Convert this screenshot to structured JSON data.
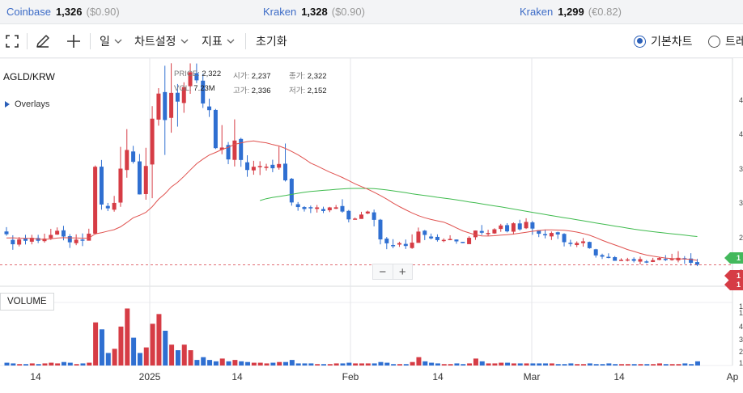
{
  "ticker": [
    {
      "exchange": "Coinbase",
      "price": "1,326",
      "change": "($0.90)"
    },
    {
      "exchange": "Kraken",
      "price": "1,328",
      "change": "($0.90)"
    },
    {
      "exchange": "Kraken",
      "price": "1,299",
      "change": "(€0.82)"
    }
  ],
  "toolbar": {
    "period": "일",
    "chart_settings": "차트설정",
    "indicators": "지표",
    "reset": "초기화",
    "basic_chart": "기본차트",
    "trading_chart_partial": "트레"
  },
  "chart": {
    "symbol": "AGLD/KRW",
    "overlays_label": "Overlays",
    "ohlc": {
      "price_label": "PRICE:",
      "price": "2,322",
      "open_label": "시가:",
      "open": "2,237",
      "close_label": "종가:",
      "close": "2,322",
      "vol_label": "VOL:",
      "vol": "7.23M",
      "high_label": "고가:",
      "high": "2,336",
      "low_label": "저가:",
      "low": "2,152"
    },
    "volume_label": "VOLUME",
    "zoom_out": "−",
    "zoom_in": "+",
    "x_labels": [
      "14",
      "2025",
      "14",
      "Feb",
      "14",
      "Mar",
      "14",
      "Ap"
    ],
    "price_tags": [
      {
        "text": "1",
        "color": "#43b85c"
      },
      {
        "text": "1",
        "color": "#d63c45"
      },
      {
        "text": "1",
        "color": "#d63c45"
      }
    ],
    "y_axis_partial": [
      "4",
      "4",
      "3",
      "3",
      "2",
      "2",
      "1",
      "1",
      "4",
      "3",
      "2",
      "1"
    ],
    "colors": {
      "up": "#d63c45",
      "down": "#2f6fd1",
      "ma_short": "#e0524f",
      "ma_long": "#3fbb4e"
    }
  },
  "chart_data": {
    "type": "candlestick",
    "note_series": [
      "price candles",
      "short moving average",
      "long moving average",
      "volume bars"
    ],
    "candles": [
      [
        2096,
        2072,
        2134,
        2059
      ],
      [
        2023,
        1985,
        2063,
        1937
      ],
      [
        1982,
        2027,
        2048,
        1966
      ],
      [
        2035,
        2015,
        2067,
        1983
      ],
      [
        2007,
        2041,
        2067,
        1984
      ],
      [
        2039,
        2015,
        2067,
        1995
      ],
      [
        2012,
        2034,
        2077,
        1999
      ],
      [
        2037,
        2066,
        2119,
        2022
      ],
      [
        2069,
        2102,
        2131,
        2066
      ],
      [
        2106,
        2052,
        2145,
        2019
      ],
      [
        2055,
        2002,
        2073,
        1953
      ],
      [
        1994,
        2025,
        2071,
        1977
      ],
      [
        2026,
        2021,
        2079,
        1969
      ],
      [
        2016,
        2077,
        2120,
        2065
      ],
      [
        2077,
        2658,
        2669,
        2069
      ],
      [
        2659,
        2330,
        2717,
        2285
      ],
      [
        2318,
        2297,
        2344,
        2273
      ],
      [
        2285,
        2344,
        2405,
        2268
      ],
      [
        2347,
        2642,
        2831,
        2310
      ],
      [
        2630,
        2804,
        2985,
        2563
      ],
      [
        2791,
        2701,
        2840,
        2686
      ],
      [
        2705,
        2418,
        2769,
        2417
      ],
      [
        2421,
        2665,
        2823,
        2372
      ],
      [
        2678,
        3076,
        3185,
        2385
      ],
      [
        3068,
        3294,
        3341,
        3015
      ],
      [
        3307,
        3064,
        3536,
        2761
      ],
      [
        3083,
        3300,
        3557,
        2954
      ],
      [
        3301,
        3224,
        3377,
        3007
      ],
      [
        3212,
        3350,
        3392,
        3127
      ],
      [
        3358,
        3479,
        3556,
        3292
      ],
      [
        3472,
        3409,
        3555,
        3385
      ],
      [
        3406,
        3208,
        3466,
        3169
      ],
      [
        3182,
        3150,
        3250,
        3091
      ],
      [
        3152,
        2820,
        3161,
        2812
      ],
      [
        2806,
        2825,
        3020,
        2767
      ],
      [
        2847,
        2722,
        2873,
        2681
      ],
      [
        2718,
        2886,
        3070,
        2661
      ],
      [
        2900,
        2717,
        2910,
        2658
      ],
      [
        2697,
        2630,
        2758,
        2571
      ],
      [
        2627,
        2658,
        2710,
        2589
      ],
      [
        2656,
        2665,
        2706,
        2586
      ],
      [
        2648,
        2659,
        2684,
        2625
      ],
      [
        2675,
        2645,
        2719,
        2611
      ],
      [
        2650,
        2682,
        2834,
        2633
      ],
      [
        2685,
        2540,
        2860,
        2530
      ],
      [
        2554,
        2348,
        2561,
        2320
      ],
      [
        2333,
        2308,
        2352,
        2276
      ],
      [
        2308,
        2291,
        2316,
        2269
      ],
      [
        2307,
        2299,
        2321,
        2256
      ],
      [
        2292,
        2305,
        2326,
        2260
      ],
      [
        2291,
        2274,
        2311,
        2256
      ],
      [
        2280,
        2305,
        2310,
        2264
      ],
      [
        2293,
        2306,
        2326,
        2291
      ],
      [
        2317,
        2269,
        2376,
        2259
      ],
      [
        2275,
        2201,
        2283,
        2175
      ],
      [
        2203,
        2208,
        2217,
        2200
      ],
      [
        2205,
        2243,
        2267,
        2206
      ],
      [
        2252,
        2269,
        2277,
        2247
      ],
      [
        2262,
        2197,
        2286,
        2140
      ],
      [
        2198,
        2027,
        2205,
        1984
      ],
      [
        2034,
        1993,
        2048,
        1942
      ],
      [
        1978,
        1968,
        2029,
        1950
      ],
      [
        1982,
        1995,
        2007,
        1962
      ],
      [
        1988,
        1970,
        2026,
        1944
      ],
      [
        1952,
        1999,
        2071,
        1945
      ],
      [
        1997,
        2095,
        2130,
        2000
      ],
      [
        2103,
        2066,
        2109,
        2021
      ],
      [
        2052,
        2036,
        2078,
        2027
      ],
      [
        2049,
        2021,
        2071,
        2008
      ],
      [
        2020,
        2023,
        2036,
        2003
      ],
      [
        2025,
        2031,
        2063,
        2020
      ],
      [
        2026,
        2010,
        2027,
        1989
      ],
      [
        2006,
        1997,
        2001,
        1995
      ],
      [
        1986,
        2041,
        2054,
        1998
      ],
      [
        2046,
        2104,
        2105,
        2023
      ],
      [
        2100,
        2085,
        2152,
        2066
      ],
      [
        2080,
        2083,
        2111,
        2055
      ],
      [
        2079,
        2115,
        2124,
        2075
      ],
      [
        2118,
        2148,
        2162,
        2093
      ],
      [
        2151,
        2097,
        2168,
        2088
      ],
      [
        2094,
        2167,
        2175,
        2069
      ],
      [
        2166,
        2114,
        2198,
        2104
      ],
      [
        2124,
        2179,
        2211,
        2117
      ],
      [
        2175,
        2121,
        2187,
        2067
      ],
      [
        2107,
        2076,
        2107,
        2047
      ],
      [
        2073,
        2067,
        2112,
        2036
      ],
      [
        2053,
        2083,
        2096,
        2022
      ],
      [
        2089,
        2070,
        2094,
        2031
      ],
      [
        2075,
        2003,
        2081,
        1966
      ],
      [
        1998,
        1989,
        2024,
        1966
      ],
      [
        1978,
        1996,
        2010,
        1960
      ],
      [
        1995,
        2010,
        2039,
        1964
      ],
      [
        2005,
        1951,
        2008,
        1946
      ],
      [
        1941,
        1888,
        1945,
        1869
      ],
      [
        1891,
        1877,
        1903,
        1857
      ],
      [
        1876,
        1874,
        1906,
        1863
      ],
      [
        1873,
        1841,
        1882,
        1843
      ],
      [
        1849,
        1850,
        1863,
        1847
      ],
      [
        1848,
        1853,
        1867,
        1836
      ],
      [
        1856,
        1841,
        1871,
        1827
      ],
      [
        1834,
        1856,
        1877,
        1810
      ],
      [
        1836,
        1833,
        1848,
        1820
      ],
      [
        1831,
        1847,
        1867,
        1830
      ],
      [
        1849,
        1865,
        1876,
        1846
      ],
      [
        1858,
        1850,
        1891,
        1839
      ],
      [
        1856,
        1858,
        1902,
        1842
      ],
      [
        1845,
        1867,
        1925,
        1828
      ],
      [
        1864,
        1862,
        1882,
        1814
      ],
      [
        1861,
        1824,
        1907,
        1800
      ],
      [
        1830,
        1807,
        1858,
        1795
      ]
    ],
    "ma_short": [
      2040,
      2041,
      2038,
      2036,
      2036,
      2030,
      2027,
      2032,
      2039,
      2042,
      2041,
      2040,
      2038,
      2039,
      2075,
      2085,
      2099,
      2112,
      2136,
      2174,
      2215,
      2236,
      2262,
      2311,
      2376,
      2424,
      2483,
      2523,
      2574,
      2630,
      2684,
      2724,
      2760,
      2783,
      2808,
      2827,
      2853,
      2865,
      2877,
      2883,
      2873,
      2866,
      2851,
      2839,
      2818,
      2791,
      2762,
      2728,
      2690,
      2665,
      2638,
      2612,
      2589,
      2565,
      2538,
      2510,
      2486,
      2464,
      2437,
      2408,
      2377,
      2343,
      2312,
      2284,
      2257,
      2233,
      2215,
      2200,
      2188,
      2177,
      2154,
      2127,
      2101,
      2084,
      2067,
      2058,
      2056,
      2059,
      2064,
      2068,
      2073,
      2081,
      2089,
      2098,
      2104,
      2110,
      2110,
      2108,
      2106,
      2099,
      2091,
      2079,
      2063,
      2043,
      2020,
      1999,
      1979,
      1960,
      1939,
      1923,
      1905,
      1891,
      1881,
      1873,
      1865,
      1860,
      1858,
      1857,
      1853,
      1845
    ],
    "ma_long": [
      null,
      null,
      null,
      null,
      null,
      null,
      null,
      null,
      null,
      null,
      null,
      null,
      null,
      null,
      null,
      null,
      null,
      null,
      null,
      null,
      null,
      null,
      null,
      null,
      null,
      null,
      null,
      null,
      null,
      null,
      null,
      null,
      null,
      null,
      null,
      null,
      null,
      null,
      null,
      null,
      2365,
      2381,
      2392,
      2400,
      2408,
      2418,
      2428,
      2437,
      2443,
      2448,
      2453,
      2457,
      2462,
      2466,
      2469,
      2470,
      2470,
      2470,
      2468,
      2463,
      2457,
      2449,
      2441,
      2433,
      2424,
      2416,
      2408,
      2401,
      2393,
      2386,
      2379,
      2371,
      2362,
      2353,
      2345,
      2336,
      2327,
      2318,
      2310,
      2301,
      2291,
      2281,
      2271,
      2262,
      2253,
      2244,
      2234,
      2225,
      2216,
      2207,
      2198,
      2189,
      2179,
      2170,
      2161,
      2152,
      2143,
      2134,
      2125,
      2116,
      2108,
      2101,
      2094,
      2088,
      2082,
      2076,
      2070,
      2064,
      2058,
      2052
    ],
    "volume": [
      0.04,
      0.03,
      0.02,
      0.02,
      0.03,
      0.02,
      0.03,
      0.04,
      0.03,
      0.05,
      0.04,
      0.02,
      0.03,
      0.04,
      0.62,
      0.52,
      0.18,
      0.24,
      0.56,
      0.82,
      0.4,
      0.18,
      0.26,
      0.6,
      0.74,
      0.5,
      0.3,
      0.22,
      0.3,
      0.22,
      0.08,
      0.12,
      0.08,
      0.06,
      0.1,
      0.06,
      0.08,
      0.06,
      0.05,
      0.04,
      0.04,
      0.03,
      0.04,
      0.05,
      0.05,
      0.08,
      0.03,
      0.03,
      0.03,
      0.02,
      0.02,
      0.02,
      0.03,
      0.03,
      0.04,
      0.03,
      0.03,
      0.03,
      0.03,
      0.05,
      0.04,
      0.02,
      0.02,
      0.02,
      0.05,
      0.12,
      0.06,
      0.04,
      0.03,
      0.02,
      0.02,
      0.03,
      0.02,
      0.03,
      0.1,
      0.06,
      0.03,
      0.03,
      0.04,
      0.04,
      0.03,
      0.03,
      0.03,
      0.03,
      0.03,
      0.03,
      0.03,
      0.02,
      0.02,
      0.03,
      0.02,
      0.02,
      0.03,
      0.02,
      0.02,
      0.03,
      0.02,
      0.02,
      0.02,
      0.02,
      0.02,
      0.02,
      0.02,
      0.03,
      0.02,
      0.02,
      0.02,
      0.03,
      0.02,
      0.06
    ],
    "last_price_line": 1807
  }
}
